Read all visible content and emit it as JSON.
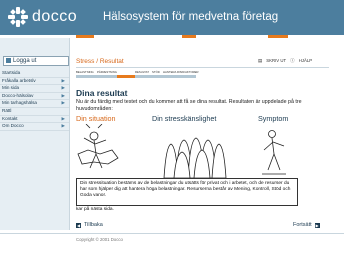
{
  "header": {
    "logo": "docco",
    "tagline": "Hälsosystem för medvetna företag",
    "colors": {
      "header_bg": "#4c7e9e",
      "accent": "#e77a1c"
    }
  },
  "sidebar": {
    "logout": "Logga ut",
    "items": [
      {
        "label": "Startsida"
      },
      {
        "label": "Fråkalla arbetslv"
      },
      {
        "label": "Min sida"
      },
      {
        "label": "Docco-hälsolav"
      },
      {
        "label": "Min tarhagshälsa"
      },
      {
        "label": "Rättl"
      },
      {
        "label": "Kontakt"
      },
      {
        "label": "Om Docco"
      }
    ]
  },
  "main": {
    "breadcrumb": "Stress / Resultat",
    "tools": {
      "print": "SKRIV UT",
      "help": "HJÄLP"
    },
    "steps": [
      "BELASTNING",
      "PÅFRESTNING",
      "RESULTAT",
      "STÖD",
      "HANTERA RISKFAKTORER"
    ],
    "heading": "Dina resultat",
    "intro": "Nu är du färdig med testet och du kommer att få se dina resultat. Resultaten är uppdelade på tre huvudområden:",
    "columns": [
      "Din situation",
      "Din stresskänslighet",
      "Symptom"
    ],
    "note": "Din stressituation bestäms av de belastningar du utsätts för privat och i arbetet, och de resurser du har som hjälper dig att hantera höga belastningar. Resurserna består av Mening, Kontroll, Stöd och Goda vanor.",
    "tail": "kar på nästa sida.",
    "back": "Tillbaka",
    "next": "Fortsätt"
  },
  "footer": {
    "copyright": "Copyright © 2001 Docco"
  }
}
